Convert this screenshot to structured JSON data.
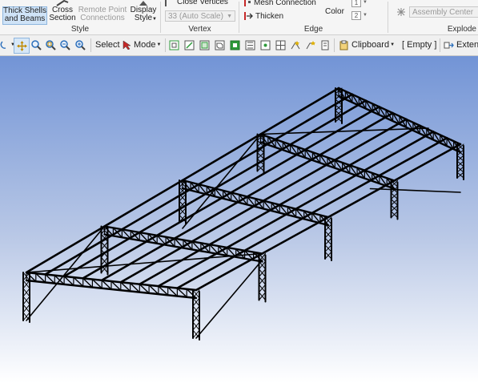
{
  "ribbon": {
    "style_group": {
      "label": "Style",
      "thick_shells": "Thick Shells and Beams",
      "cross_section": "Cross Section",
      "remote_point": "Remote Point Connections",
      "display_style": "Display Style"
    },
    "vertex_group": {
      "label": "Vertex",
      "close_vertices": "Close Vertices",
      "scale_value": "33 (Auto Scale)"
    },
    "edge_group": {
      "label": "Edge",
      "mesh_connection": "Mesh Connection",
      "thicken": "Thicken",
      "color": "Color",
      "box1": "1",
      "box2": "2"
    },
    "explode_group": {
      "label": "Explode",
      "assembly_center": "Assembly Center"
    }
  },
  "toolbar": {
    "select_label": "Select",
    "mode_label": "Mode",
    "clipboard_label": "Clipboard",
    "empty_label": "[ Empty ]",
    "extend_label": "Extend"
  },
  "colors": {
    "accent": "#2a6ebb",
    "frame": "#000000",
    "edge_red": "#c62828",
    "green_icon": "#2e9a3a",
    "viewport_top": "#7294d6",
    "viewport_bottom": "#ffffff"
  }
}
